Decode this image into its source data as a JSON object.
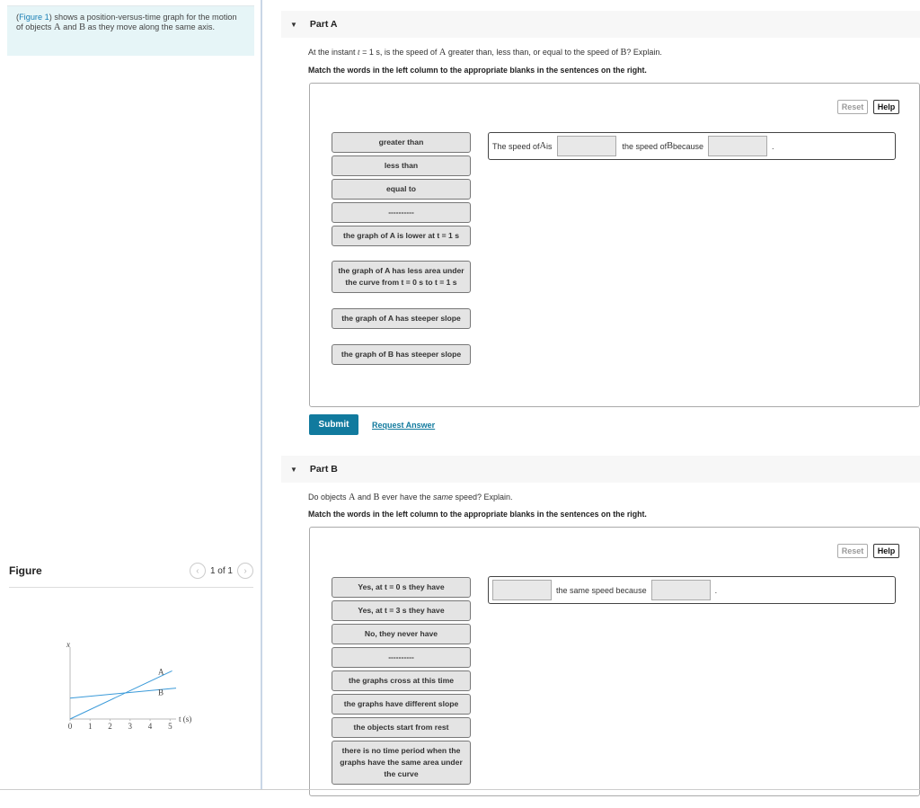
{
  "intro": {
    "figure_link": "Figure 1",
    "text_pre": ") shows a position-versus-time graph for the motion of objects ",
    "obj_a": "A",
    "text_and": " and ",
    "obj_b": "B",
    "text_post": " as they move along the same axis."
  },
  "figure": {
    "title": "Figure",
    "pager": "1 of 1",
    "prev_icon": "‹",
    "next_icon": "›"
  },
  "chart_data": {
    "type": "line",
    "xlabel": "t (s)",
    "ylabel": "x",
    "x_ticks": [
      "0",
      "1",
      "2",
      "3",
      "4",
      "5"
    ],
    "xlim": [
      0,
      5.3
    ],
    "ylim": [
      0,
      10
    ],
    "series": [
      {
        "name": "A",
        "x": [
          0,
          5.1
        ],
        "y": [
          0,
          6.7
        ],
        "color": "#3a9ad9"
      },
      {
        "name": "B",
        "x": [
          0,
          5.3
        ],
        "y": [
          2.9,
          4.3
        ],
        "color": "#3a9ad9"
      }
    ],
    "labels": [
      {
        "text": "A",
        "x": 4.4,
        "y": 6.2
      },
      {
        "text": "B",
        "x": 4.4,
        "y": 3.3
      }
    ]
  },
  "partA": {
    "header": "Part A",
    "q_pre": "At the instant ",
    "q_t": "t",
    "q_eq": " = 1 s",
    "q_mid": ", is the speed of ",
    "q_a": "A",
    "q_mid2": " greater than, less than, or equal to the speed of ",
    "q_b": "B",
    "q_post": "? Explain.",
    "instruction": "Match the words in the left column to the appropriate blanks in the sentences on the right.",
    "reset": "Reset",
    "help": "Help",
    "chips": [
      "greater than",
      "less than",
      "equal to",
      "----------",
      "the graph of A is lower at t = 1 s",
      "the graph of A has less area under the curve from t = 0 s to t = 1 s",
      "the graph of A has steeper slope",
      "the graph of B has steeper slope"
    ],
    "sentence": {
      "s1": "The speed of ",
      "a": "A",
      "s2": " is",
      "s3": "the speed of ",
      "b": "B",
      "s4": " because",
      "end": "."
    },
    "submit": "Submit",
    "request_answer": "Request Answer"
  },
  "partB": {
    "header": "Part B",
    "q_pre": "Do objects ",
    "q_a": "A",
    "q_and": " and ",
    "q_b": "B",
    "q_mid": " ever have the ",
    "q_em": "same",
    "q_post": " speed? Explain.",
    "instruction": "Match the words in the left column to the appropriate blanks in the sentences on the right.",
    "reset": "Reset",
    "help": "Help",
    "chips": [
      "Yes, at t = 0 s they have",
      "Yes, at t = 3 s they have",
      "No, they never have",
      "----------",
      "the graphs cross at this time",
      "the graphs have different slope",
      "the objects start from rest",
      "there is no time period when the graphs have the same area under the curve"
    ],
    "sentence": {
      "s1": "the same speed because",
      "end": "."
    }
  },
  "colors": {
    "accent": "#117a9e",
    "link": "#1a7fb5",
    "intro_bg": "#e6f5f7",
    "graph_line": "#3a9ad9"
  }
}
